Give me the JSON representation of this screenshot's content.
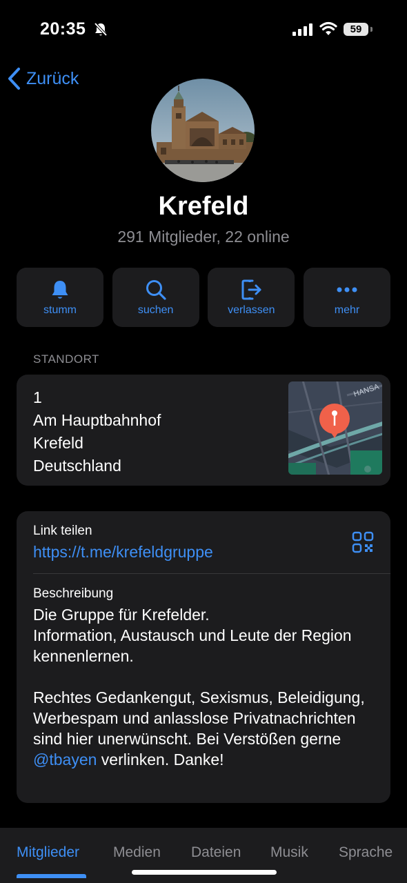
{
  "status": {
    "time": "20:35",
    "battery": "59"
  },
  "nav": {
    "back_label": "Zurück"
  },
  "group": {
    "title": "Krefeld",
    "subtitle": "291 Mitglieder, 22 online"
  },
  "actions": [
    {
      "label": "stumm",
      "icon": "bell-icon"
    },
    {
      "label": "suchen",
      "icon": "search-icon"
    },
    {
      "label": "verlassen",
      "icon": "leave-icon"
    },
    {
      "label": "mehr",
      "icon": "more-icon"
    }
  ],
  "location": {
    "header": "STANDORT",
    "line1": "1",
    "line2": "Am Hauptbahnhof",
    "line3": "Krefeld",
    "line4": "Deutschland",
    "map_street_label": "HANSA"
  },
  "info": {
    "link_label": "Link teilen",
    "link_url": "https://t.me/krefeldgruppe",
    "description_label": "Beschreibung",
    "description_part1": "Die Gruppe für Krefelder.\nInformation, Austausch und Leute der Region kennenlernen.\n\nRechtes Gedankengut, Sexismus, Beleidigung, Werbespam und anlasslose Privatnachrichten sind hier unerwünscht. Bei Verstößen gerne ",
    "mention": "@tbayen",
    "description_part2": " verlinken. Danke!"
  },
  "tabs": [
    {
      "label": "Mitglieder",
      "active": true
    },
    {
      "label": "Medien"
    },
    {
      "label": "Dateien"
    },
    {
      "label": "Musik"
    },
    {
      "label": "Sprache"
    }
  ],
  "colors": {
    "accent": "#3e8ff5",
    "card": "#1c1c1e",
    "map_pin": "#f0614a"
  }
}
